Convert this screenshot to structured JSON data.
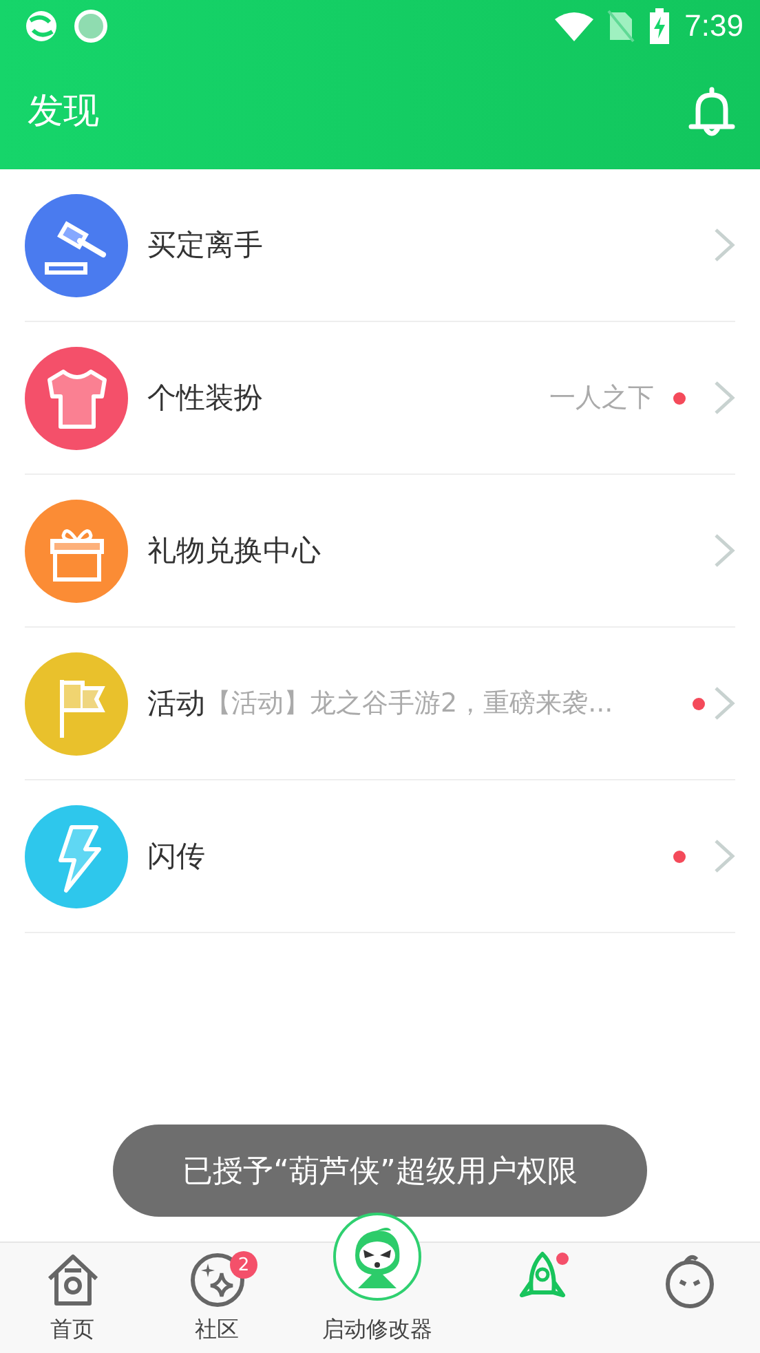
{
  "status_bar": {
    "time": "7:39"
  },
  "header": {
    "title": "发现"
  },
  "items": [
    {
      "kind": "auction",
      "title": "买定离手",
      "color": "#4a7bef",
      "new": false
    },
    {
      "kind": "shirt",
      "title": "个性装扮",
      "subtitle": "一人之下",
      "color": "#f4506a",
      "new": true
    },
    {
      "kind": "gift",
      "title": "礼物兑换中心",
      "color": "#fb8c35",
      "new": false
    },
    {
      "kind": "flag",
      "title": "活动",
      "subtitle": "【活动】龙之谷手游2，重磅来袭...",
      "color": "#e9c12c",
      "new": true
    },
    {
      "kind": "bolt",
      "title": "闪传",
      "color": "#2ec7ec",
      "new": true
    }
  ],
  "toast": "已授予“葫芦侠”超级用户权限",
  "tabs": [
    {
      "kind": "home",
      "label": "首页",
      "selected": false
    },
    {
      "kind": "community",
      "label": "社区",
      "badge": "2",
      "selected": false
    },
    {
      "kind": "launcher",
      "label": "启动修改器",
      "selected": false
    },
    {
      "kind": "rocket",
      "selected": true,
      "dot": true
    },
    {
      "kind": "face",
      "selected": false
    }
  ]
}
